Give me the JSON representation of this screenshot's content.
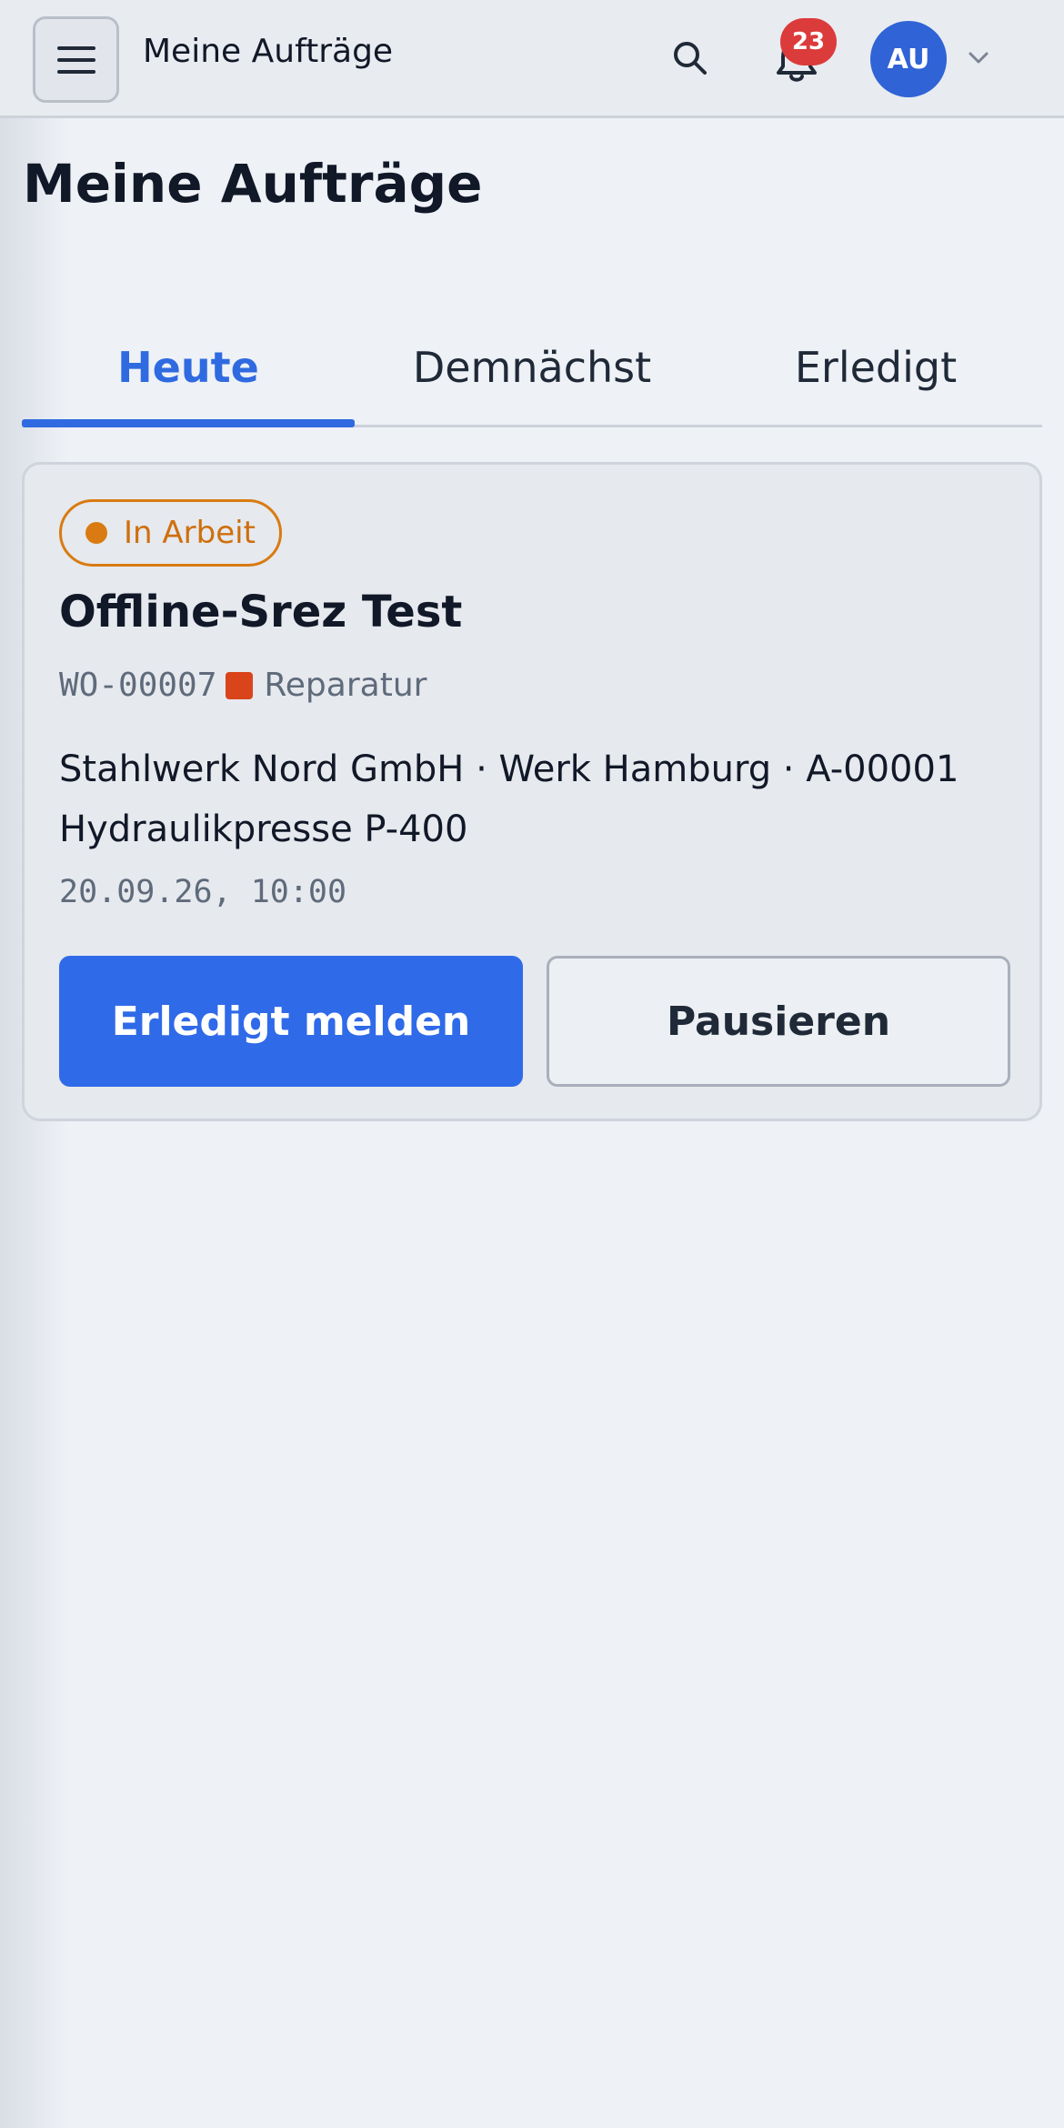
{
  "header": {
    "title": "Meine Aufträge",
    "notification_count": "23",
    "avatar_initials": "AU",
    "icons": [
      "menu-icon",
      "search-icon",
      "bell-icon",
      "chevron-down-icon"
    ]
  },
  "page": {
    "title": "Meine Aufträge"
  },
  "tabs": [
    {
      "label": "Heute",
      "active": true
    },
    {
      "label": "Demnächst",
      "active": false
    },
    {
      "label": "Erledigt",
      "active": false
    }
  ],
  "work_order": {
    "status": "In Arbeit",
    "status_color": "#d97b12",
    "title": "Offline-Srez Test",
    "number": "WO-00007",
    "type": "Reparatur",
    "type_color": "#d9441a",
    "location": "Stahlwerk Nord GmbH · Werk Hamburg · A-00001 Hydraulikpresse P-400",
    "datetime": "20.09.26, 10:00",
    "primary_action": "Erledigt melden",
    "secondary_action": "Pausieren"
  },
  "colors": {
    "accent": "#2f6ae0",
    "badge": "#dc3b3b",
    "avatar": "#2f63d6",
    "background": "#eef1f6"
  }
}
